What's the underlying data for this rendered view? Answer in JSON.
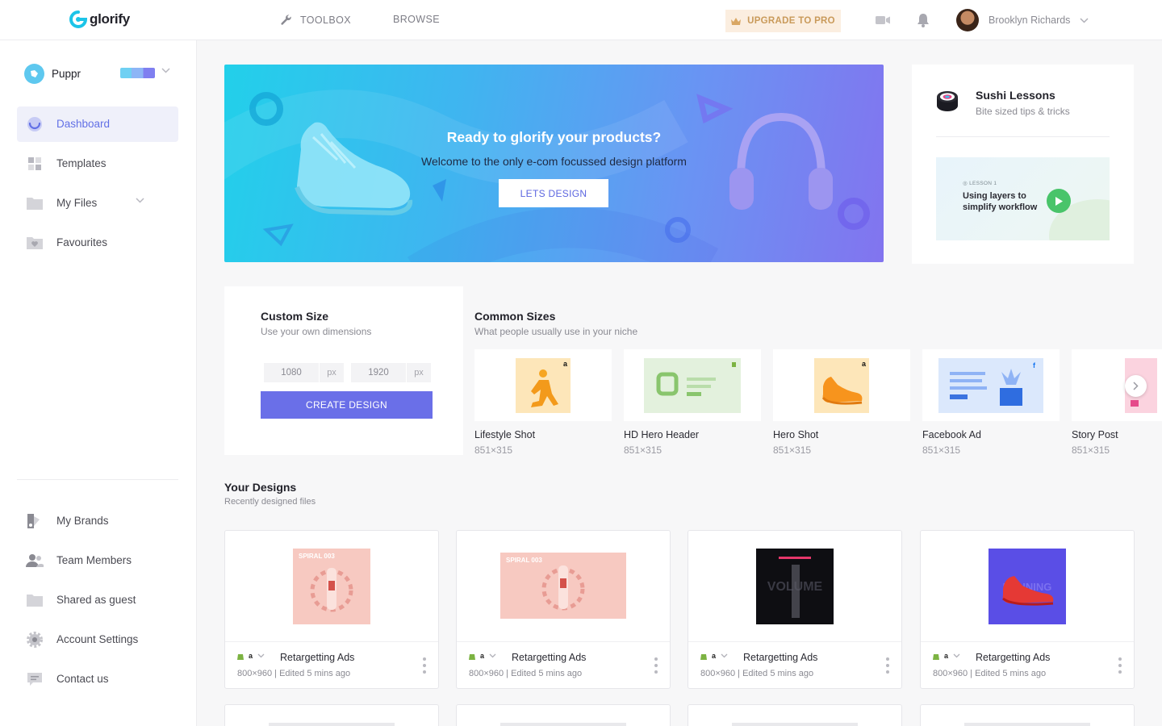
{
  "app": {
    "brand": "glorify"
  },
  "topbar": {
    "toolbox": "TOOLBOX",
    "browse": "BROWSE",
    "upgrade": "UPGRADE TO PRO",
    "user_name": "Brooklyn Richards"
  },
  "sidebar": {
    "workspace": "Puppr",
    "items": [
      {
        "label": "Dashboard",
        "icon": "dashboard-icon",
        "active": true
      },
      {
        "label": "Templates",
        "icon": "templates-icon"
      },
      {
        "label": "My Files",
        "icon": "folder-icon"
      },
      {
        "label": "Favourites",
        "icon": "heart-folder-icon"
      }
    ],
    "bottom_items": [
      {
        "label": "My Brands",
        "icon": "brands-icon"
      },
      {
        "label": "Team Members",
        "icon": "team-icon"
      },
      {
        "label": "Shared as guest",
        "icon": "shared-folder-icon"
      },
      {
        "label": "Account Settings",
        "icon": "gear-icon"
      },
      {
        "label": "Contact us",
        "icon": "chat-icon"
      }
    ]
  },
  "banner": {
    "title": "Ready to glorify your products?",
    "subtitle": "Welcome to the only e-com focussed design platform",
    "button": "LETS DESIGN"
  },
  "lessons": {
    "title": "Sushi Lessons",
    "subtitle": "Bite sized tips & tricks",
    "card_tag": "LESSON 1",
    "card_text": "Using layers to simplify workflow"
  },
  "custom_size": {
    "title": "Custom Size",
    "subtitle": "Use your own dimensions",
    "width": "1080",
    "height": "1920",
    "unit": "px",
    "button": "CREATE DESIGN"
  },
  "common_sizes": {
    "title": "Common Sizes",
    "subtitle": "What people usually use in your niche",
    "items": [
      {
        "name": "Lifestyle Shot",
        "dims": "851×315"
      },
      {
        "name": "HD Hero Header",
        "dims": "851×315"
      },
      {
        "name": "Hero Shot",
        "dims": "851×315"
      },
      {
        "name": "Facebook Ad",
        "dims": "851×315"
      },
      {
        "name": "Story Post",
        "dims": "851×315"
      }
    ]
  },
  "your_designs": {
    "title": "Your Designs",
    "subtitle": "Recently designed files",
    "items": [
      {
        "title": "Retargetting Ads",
        "info": "800×960 | Edited 5 mins ago",
        "thumb_text": "SPIRAL 003"
      },
      {
        "title": "Retargetting Ads",
        "info": "800×960 | Edited 5 mins ago",
        "thumb_text": "SPIRAL 003"
      },
      {
        "title": "Retargetting Ads",
        "info": "800×960 | Edited 5 mins ago",
        "thumb_text": "VOLUME"
      },
      {
        "title": "Retargetting Ads",
        "info": "800×960 | Edited 5 mins ago",
        "thumb_text": "RUNNING"
      }
    ]
  },
  "colors": {
    "accent": "#6a6fe8",
    "active_bg": "#eff0fa",
    "upgrade_bg": "#fbeee0",
    "upgrade_text": "#c99a5a",
    "play": "#49c46a"
  }
}
